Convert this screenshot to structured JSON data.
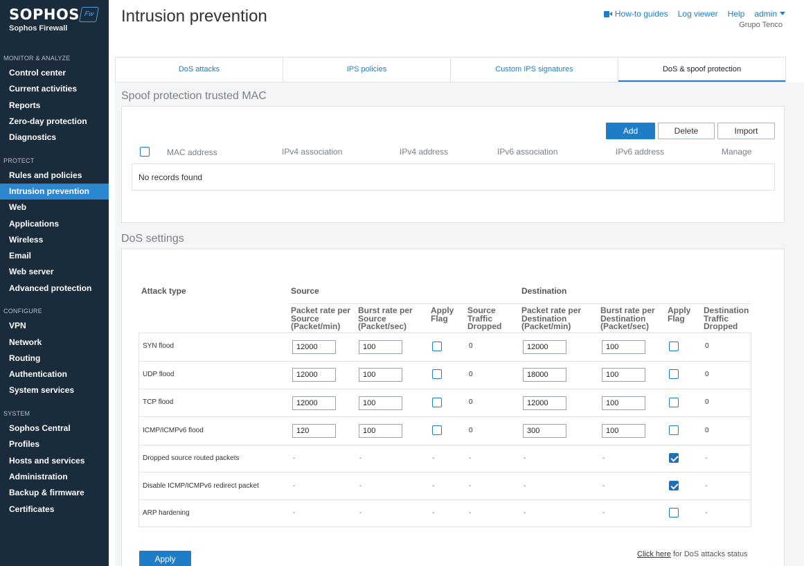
{
  "brand": {
    "name": "SOPHOS",
    "product": "Sophos Firewall",
    "badge": "Fw"
  },
  "sidebar": {
    "sections": [
      {
        "title": "MONITOR & ANALYZE",
        "items": [
          "Control center",
          "Current activities",
          "Reports",
          "Zero-day protection",
          "Diagnostics"
        ]
      },
      {
        "title": "PROTECT",
        "items": [
          "Rules and policies",
          "Intrusion prevention",
          "Web",
          "Applications",
          "Wireless",
          "Email",
          "Web server",
          "Advanced protection"
        ]
      },
      {
        "title": "CONFIGURE",
        "items": [
          "VPN",
          "Network",
          "Routing",
          "Authentication",
          "System services"
        ]
      },
      {
        "title": "SYSTEM",
        "items": [
          "Sophos Central",
          "Profiles",
          "Hosts and services",
          "Administration",
          "Backup & firmware",
          "Certificates"
        ]
      }
    ],
    "active": "Intrusion prevention"
  },
  "header": {
    "title": "Intrusion prevention",
    "how_to": "How-to guides",
    "log_viewer": "Log viewer",
    "help": "Help",
    "user": "admin",
    "org": "Grupo Tenco"
  },
  "tabs": [
    "DoS attacks",
    "IPS policies",
    "Custom IPS signatures",
    "DoS & spoof protection"
  ],
  "spoof": {
    "title": "Spoof protection trusted MAC",
    "add": "Add",
    "delete": "Delete",
    "import": "Import",
    "columns": [
      "MAC address",
      "IPv4 association",
      "IPv4 address",
      "IPv6 association",
      "IPv6 address",
      "Manage"
    ],
    "empty": "No records found"
  },
  "dos": {
    "title": "DoS settings",
    "attack_type": "Attack type",
    "source": "Source",
    "destination": "Destination",
    "sub_headers": [
      [
        "Packet rate per",
        "Source",
        "(Packet/min)"
      ],
      [
        "Burst rate per",
        "Source",
        "(Packet/sec)"
      ],
      [
        "Apply",
        "Flag"
      ],
      [
        "Source",
        "Traffic",
        "Dropped"
      ],
      [
        "Packet rate per",
        "Destination",
        "(Packet/min)"
      ],
      [
        "Burst rate per",
        "Destination",
        "(Packet/sec)"
      ],
      [
        "Apply",
        "Flag"
      ],
      [
        "Destination",
        "Traffic",
        "Dropped"
      ]
    ],
    "rows": [
      {
        "label": "SYN flood",
        "src_rate": "12000",
        "src_burst": "100",
        "src_flag": false,
        "src_dropped": "0",
        "dst_rate": "12000",
        "dst_burst": "100",
        "dst_flag": false,
        "dst_dropped": "0"
      },
      {
        "label": "UDP flood",
        "src_rate": "12000",
        "src_burst": "100",
        "src_flag": false,
        "src_dropped": "0",
        "dst_rate": "18000",
        "dst_burst": "100",
        "dst_flag": false,
        "dst_dropped": "0"
      },
      {
        "label": "TCP flood",
        "src_rate": "12000",
        "src_burst": "100",
        "src_flag": false,
        "src_dropped": "0",
        "dst_rate": "12000",
        "dst_burst": "100",
        "dst_flag": false,
        "dst_dropped": "0"
      },
      {
        "label": "ICMP/ICMPv6 flood",
        "src_rate": "120",
        "src_burst": "100",
        "src_flag": false,
        "src_dropped": "0",
        "dst_rate": "300",
        "dst_burst": "100",
        "dst_flag": false,
        "dst_dropped": "0"
      }
    ],
    "flag_rows": [
      {
        "label": "Dropped source routed packets",
        "flag": true
      },
      {
        "label": "Disable ICMP/ICMPv6 redirect packet",
        "flag": true
      },
      {
        "label": "ARP hardening",
        "flag": false
      }
    ],
    "dash": "-",
    "apply": "Apply",
    "click_here": "Click here",
    "status_text": " for DoS attacks status"
  }
}
